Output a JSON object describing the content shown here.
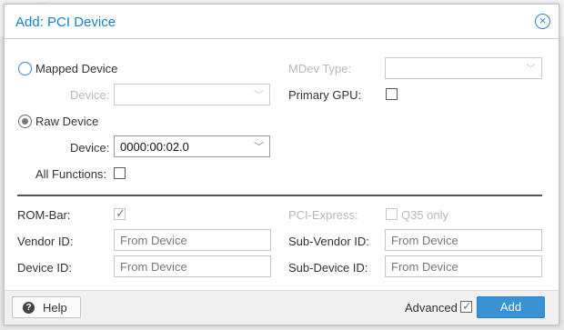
{
  "background": {
    "text": "...",
    "color": "#bdbdbd"
  },
  "dialog": {
    "title": "Add: PCI Device",
    "close_icon": "close-circle-icon"
  },
  "mapped_device": {
    "label": "Mapped Device",
    "device_label": "Device:",
    "device_value": ""
  },
  "mdev_type": {
    "label": "MDev Type:",
    "value": ""
  },
  "primary_gpu": {
    "label": "Primary GPU:",
    "checked": false
  },
  "raw_device": {
    "label": "Raw Device",
    "device_label": "Device:",
    "device_value": "0000:00:02.0"
  },
  "all_functions": {
    "label": "All Functions:",
    "checked": false
  },
  "rom_bar": {
    "label": "ROM-Bar:",
    "checked": true
  },
  "pci_express": {
    "label": "PCI-Express:",
    "checked": false,
    "option_label": "Q35 only"
  },
  "vendor_id": {
    "label": "Vendor ID:",
    "placeholder": "From Device"
  },
  "sub_vendor_id": {
    "label": "Sub-Vendor ID:",
    "placeholder": "From Device"
  },
  "device_id": {
    "label": "Device ID:",
    "placeholder": "From Device"
  },
  "sub_device_id": {
    "label": "Sub-Device ID:",
    "placeholder": "From Device"
  },
  "footer": {
    "help_label": "Help",
    "help_icon": "question-circle-icon",
    "advanced_label": "Advanced",
    "advanced_checked": true,
    "add_label": "Add"
  },
  "colors": {
    "accent": "#157fcc",
    "button": "#3892d4",
    "separator": "#555555"
  }
}
